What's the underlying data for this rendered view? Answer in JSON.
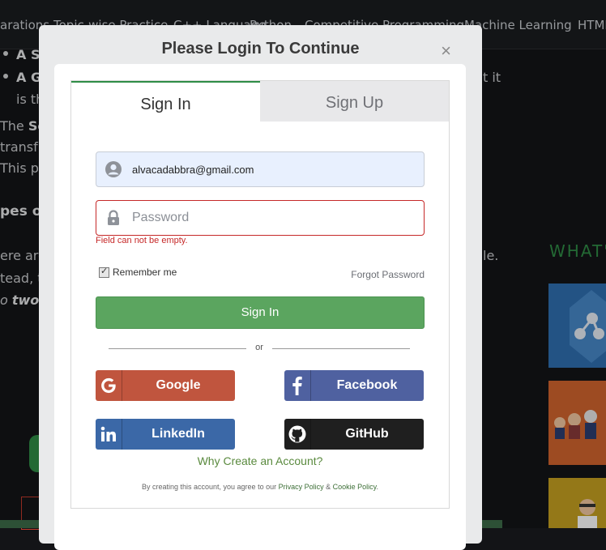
{
  "background": {
    "nav_items": [
      "arations",
      "Topic-wise Practice",
      "C++ Language",
      "Python",
      "Competitive Programming",
      "Machine Learning",
      "HTML"
    ],
    "bullet1": "A S",
    "bullet2": "A G",
    "bullet2_tail": "t it",
    "line3": "is th",
    "line4a": "The ",
    "line4b": "So",
    "line5": "transf",
    "line6": "This pl",
    "heading": "pes of",
    "line7": "ere are",
    "line7_tail": "le.",
    "line8": "tead, t",
    "line9a": "o ",
    "line9b": "two",
    "line9c": " c",
    "whats_new": "WHAT'",
    "accent": "#2f8d46"
  },
  "modal": {
    "title": "Please Login To Continue",
    "close": "×",
    "tabs": {
      "signin": "Sign In",
      "signup": "Sign Up"
    },
    "email_value": "alvacadabbra@gmail.com",
    "password_placeholder": "Password",
    "error_text": "Field can not be empty.",
    "remember_label": "Remember me",
    "forgot_label": "Forgot Password",
    "signin_button": "Sign In",
    "or_text": "or",
    "social": {
      "google": "Google",
      "facebook": "Facebook",
      "linkedin": "LinkedIn",
      "github": "GitHub"
    },
    "why_label": "Why Create an Account?",
    "terms": {
      "prefix": "By creating this account, you agree to our ",
      "privacy": "Privacy Policy",
      "amp": " & ",
      "cookie": "Cookie Policy",
      "suffix": "."
    },
    "colors": {
      "signin_green": "#5ba55f",
      "error_red": "#c62828",
      "google": "#c0553e",
      "facebook": "#4f61a0",
      "linkedin": "#3b68a7",
      "github": "#1f1f1f"
    }
  }
}
